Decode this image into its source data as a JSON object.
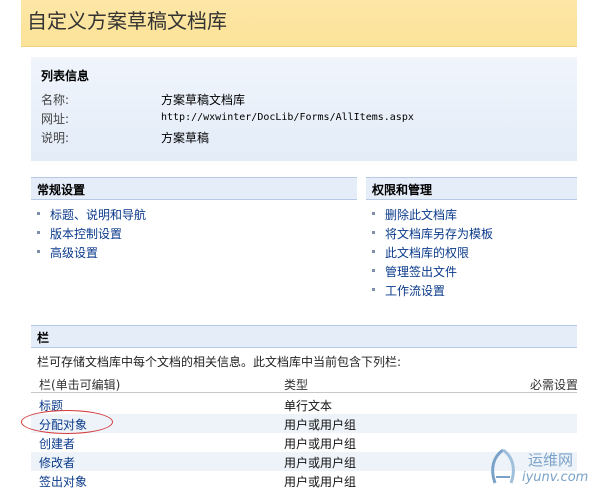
{
  "page_title": "自定义方案草稿文档库",
  "list_info": {
    "header": "列表信息",
    "rows": [
      {
        "label": "名称:",
        "value": "方案草稿文档库"
      },
      {
        "label": "网址:",
        "value": "http://wxwinter/DocLib/Forms/AllItems.aspx"
      },
      {
        "label": "说明:",
        "value": "方案草稿"
      }
    ]
  },
  "general_settings": {
    "header": "常规设置",
    "links": [
      "标题、说明和导航",
      "版本控制设置",
      "高级设置"
    ]
  },
  "permissions": {
    "header": "权限和管理",
    "links": [
      "删除此文档库",
      "将文档库另存为模板",
      "此文档库的权限",
      "管理签出文件",
      "工作流设置"
    ]
  },
  "columns": {
    "header": "栏",
    "description": "栏可存储文档库中每个文档的相关信息。此文档库中当前包含下列栏:",
    "col_headers": [
      "栏(单击可编辑)",
      "类型",
      "必需设置"
    ],
    "rows": [
      {
        "name": "标题",
        "type": "单行文本"
      },
      {
        "name": "分配对象",
        "type": "用户或用户组"
      },
      {
        "name": "创建者",
        "type": "用户或用户组"
      },
      {
        "name": "修改者",
        "type": "用户或用户组"
      },
      {
        "name": "签出对象",
        "type": "用户或用户组"
      }
    ]
  },
  "watermark": {
    "line1": "运维网",
    "line2": "iyunv.com"
  }
}
